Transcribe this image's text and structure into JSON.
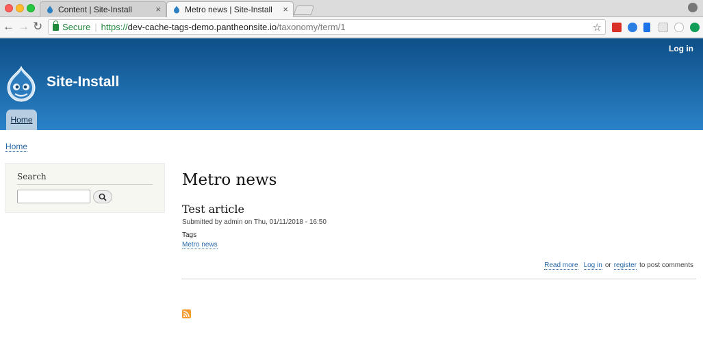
{
  "browser": {
    "tabs": [
      {
        "title": "Content | Site-Install",
        "active": false
      },
      {
        "title": "Metro news | Site-Install",
        "active": true
      }
    ],
    "close_glyph": "×",
    "address": {
      "secure_label": "Secure",
      "url_scheme": "https://",
      "url_host": "dev-cache-tags-demo.pantheonsite.io",
      "url_path": "/taxonomy/term/1"
    },
    "nav": {
      "back": "←",
      "forward": "→",
      "reload": "↻",
      "star": "☆"
    },
    "extensions": [
      "#d93025",
      "#2a7de1",
      "#1a73e8",
      "#cfcfcf",
      "#bdbdbd",
      "#0f9d58"
    ]
  },
  "site": {
    "login": "Log in",
    "name": "Site-Install",
    "nav_home": "Home"
  },
  "breadcrumb": "Home",
  "sidebar": {
    "search_title": "Search",
    "search_value": ""
  },
  "main": {
    "page_title": "Metro news",
    "article": {
      "title": "Test article",
      "submitted": "Submitted by admin on Thu, 01/11/2018 - 16:50",
      "tags_label": "Tags",
      "tag": "Metro news",
      "read_more": "Read more",
      "login": "Log in",
      "or_text": "or",
      "register": "register",
      "post_text": "to post comments"
    }
  },
  "colors": {
    "header_top": "#0e4f87",
    "header_bottom": "#2a82c8",
    "link": "#2568a8",
    "feed": "#f59b30"
  }
}
